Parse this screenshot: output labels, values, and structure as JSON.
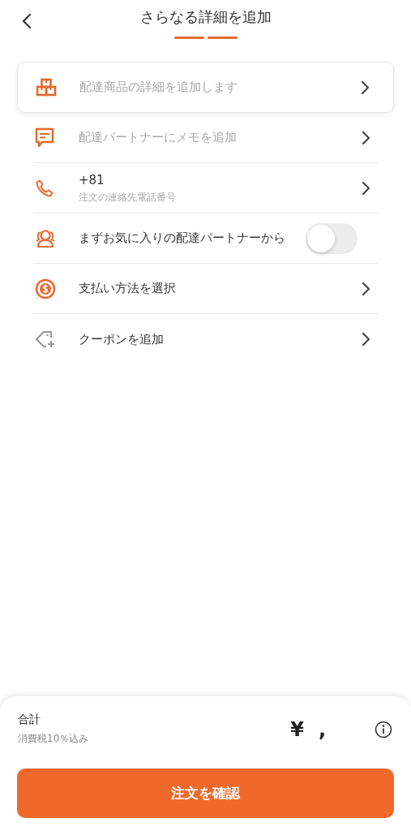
{
  "header": {
    "title": "さらなる詳細を追加",
    "steps": [
      {
        "active": true
      },
      {
        "active": true
      }
    ]
  },
  "rows": [
    {
      "kind": "card",
      "label": "配達商品の詳細を追加します",
      "hint": true
    },
    {
      "kind": "link",
      "label": "配達パートナーにメモを追加",
      "hint": true
    },
    {
      "kind": "link",
      "label": "+81",
      "sub": "注文の連絡先電話番号",
      "hint": false
    },
    {
      "kind": "toggle",
      "label": "まずお気に入りの配達パートナーから",
      "hint": false,
      "on": false
    },
    {
      "kind": "link",
      "label": "支払い方法を選択",
      "hint": false
    },
    {
      "kind": "link",
      "label": "クーポンを追加",
      "hint": false
    }
  ],
  "footer": {
    "total_label": "合計",
    "tax_note": "消費税10％込み",
    "currency": "¥",
    "amount": ",",
    "confirm_button": "注文を確認"
  }
}
